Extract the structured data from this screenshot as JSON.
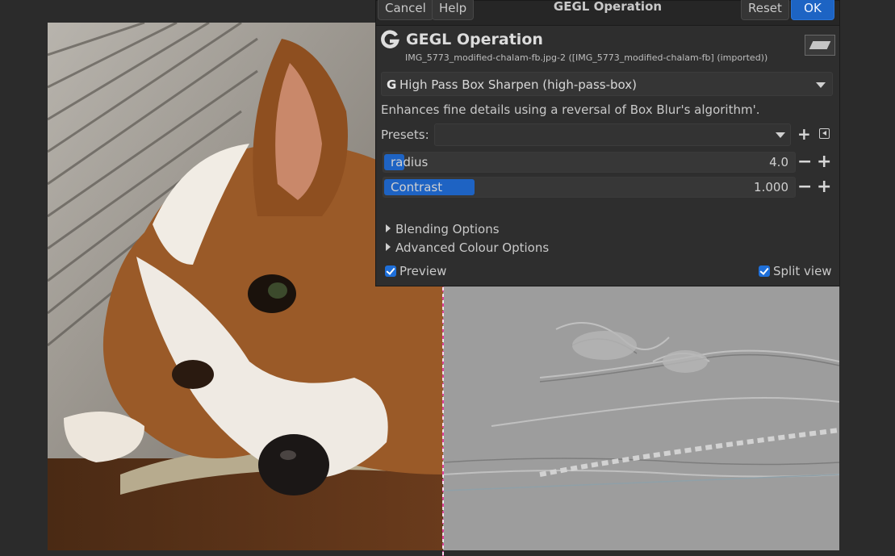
{
  "header": {
    "title": "GEGL Operation",
    "cancel_label": "Cancel",
    "help_label": "Help",
    "reset_label": "Reset",
    "ok_label": "OK"
  },
  "operation": {
    "logo_letter": "G",
    "title": "GEGL Operation",
    "subtitle": "IMG_5773_modified-chalam-fb.jpg-2 ([IMG_5773_modified-chalam-fb] (imported))",
    "selected": "High Pass Box Sharpen (high-pass-box)",
    "description": "Enhances fine details using a reversal of Box Blur's algorithm'."
  },
  "presets": {
    "label": "Presets:",
    "value": ""
  },
  "params": {
    "radius": {
      "label": "radius",
      "value": "4.0",
      "fill_fraction": 0.05
    },
    "contrast": {
      "label": "Contrast",
      "value": "1.000",
      "fill_fraction": 0.22
    }
  },
  "expanders": {
    "blending": "Blending Options",
    "colour": "Advanced Colour Options"
  },
  "checks": {
    "preview_label": "Preview",
    "preview_checked": true,
    "split_label": "Split view",
    "split_checked": true
  },
  "colors": {
    "accent": "#1e63c3",
    "split_line": "#e0409c"
  }
}
